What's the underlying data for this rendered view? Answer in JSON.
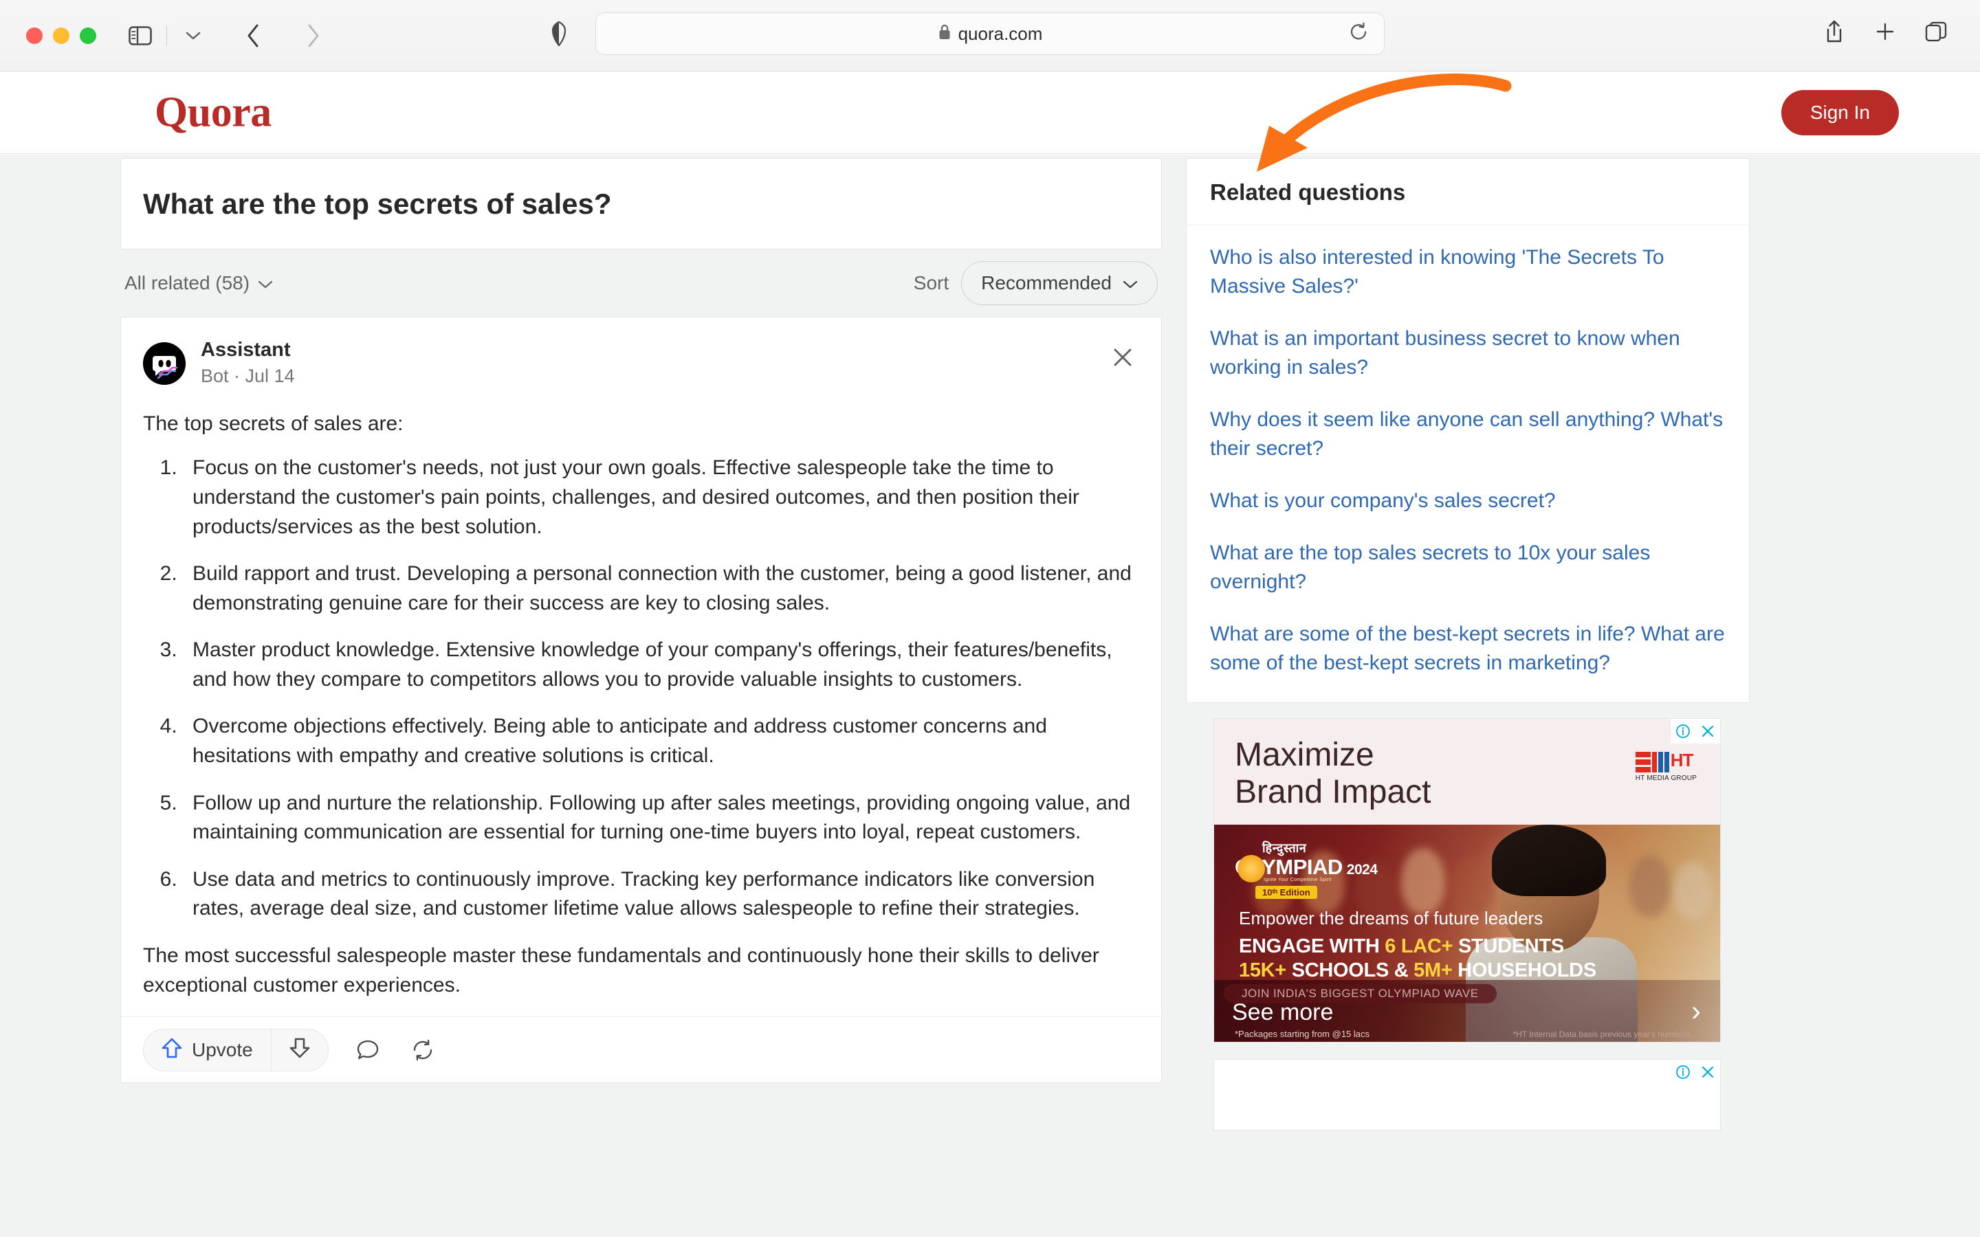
{
  "browser": {
    "url": "quora.com",
    "lock_icon": "lock-icon",
    "sidebar_icon": "sidebar-toggle-icon",
    "tabgroup_icon": "chevron-down-icon",
    "back_icon": "back-arrow-icon",
    "forward_icon": "forward-arrow-icon",
    "shield_icon": "privacy-shield-icon",
    "reload_icon": "reload-icon",
    "share_icon": "share-icon",
    "newtab_icon": "plus-icon",
    "tabs_icon": "tabs-overview-icon"
  },
  "header": {
    "logo": "Quora",
    "signin_label": "Sign In",
    "brand_color": "#b92b27"
  },
  "question": {
    "title": "What are the top secrets of sales?"
  },
  "sortbar": {
    "all_related_label": "All related (58)",
    "sort_label": "Sort",
    "sort_value": "Recommended",
    "chevron_icon": "chevron-down-icon"
  },
  "answer": {
    "author": "Assistant",
    "meta": "Bot · Jul 14",
    "avatar_icon": "assistant-bot-avatar-icon",
    "close_icon": "close-icon",
    "lead": "The top secrets of sales are:",
    "points": [
      "Focus on the customer's needs, not just your own goals. Effective salespeople take the time to understand the customer's pain points, challenges, and desired outcomes, and then position their products/services as the best solution.",
      "Build rapport and trust. Developing a personal connection with the customer, being a good listener, and demonstrating genuine care for their success are key to closing sales.",
      "Master product knowledge. Extensive knowledge of your company's offerings, their features/benefits, and how they compare to competitors allows you to provide valuable insights to customers.",
      "Overcome objections effectively. Being able to anticipate and address customer concerns and hesitations with empathy and creative solutions is critical.",
      "Follow up and nurture the relationship. Following up after sales meetings, providing ongoing value, and maintaining communication are essential for turning one-time buyers into loyal, repeat customers.",
      "Use data and metrics to continuously improve. Tracking key performance indicators like conversion rates, average deal size, and customer lifetime value allows salespeople to refine their strategies."
    ],
    "closing": "The most successful salespeople master these fundamentals and continuously hone their skills to deliver exceptional customer experiences.",
    "actions": {
      "upvote_label": "Upvote",
      "upvote_icon": "upvote-arrow-icon",
      "downvote_icon": "downvote-arrow-icon",
      "comment_icon": "comment-bubble-icon",
      "share_icon": "repost-icon",
      "upvote_color": "#2e69f0"
    }
  },
  "related": {
    "title": "Related questions",
    "items": [
      "Who is also interested in knowing 'The Secrets To Massive Sales?'",
      "What is an important business secret to know when working in sales?",
      "Why does it seem like anyone can sell anything? What's their secret?",
      "What is your company's sales secret?",
      "What are the top sales secrets to 10x your sales overnight?",
      "What are some of the best-kept secrets in life? What are some of the best-kept secrets in marketing?"
    ],
    "link_color": "#2e69b2"
  },
  "ad": {
    "info_icon": "ad-info-icon",
    "close_icon": "ad-close-icon",
    "headline_line1": "Maximize",
    "headline_line2": "Brand Impact",
    "brand_mark": "HT",
    "brand_caption": "HT MEDIA GROUP",
    "olympiad_hindi": "हिन्दुस्तान",
    "olympiad_title": "OLYMPIAD",
    "olympiad_year": "2024",
    "olympiad_tagline": "Ignite Your Competitive Spirit",
    "olympiad_edition": "10ᵗʰ Edition",
    "copy_line1": "Empower the dreams of future leaders",
    "copy_line2_a": "ENGAGE WITH ",
    "copy_line2_hl": "6 LAC+",
    "copy_line2_b": " STUDENTS",
    "copy_line3_hl1": "15K+",
    "copy_line3_a": " SCHOOLS & ",
    "copy_line3_hl2": "5M+",
    "copy_line3_b": " HOUSEHOLDS",
    "cta_band": "JOIN INDIA'S BIGGEST OLYMPIAD WAVE",
    "cta_label": "See more",
    "fineprint_left": "*Packages starting from @15 lacs",
    "fineprint_right": "*HT Internal Data basis previous year's numbers",
    "chevron_icon": "chevron-right-icon"
  },
  "ad2": {
    "info_icon": "ad-info-icon",
    "close_icon": "ad-close-icon"
  },
  "annotation": {
    "arrow_color": "#F97316",
    "target": "related-questions-panel"
  }
}
